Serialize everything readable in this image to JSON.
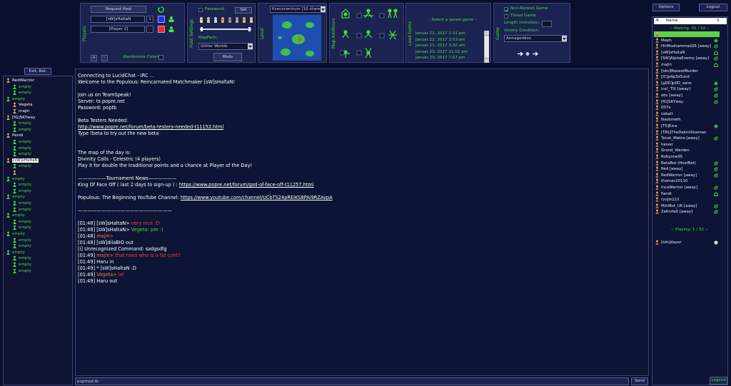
{
  "header": {
    "players_label": "Players",
    "request_host": "Request Host",
    "player1": "[sW]sHaltaN",
    "player1_num": "1",
    "player2": "[Player 2]",
    "player2_num": "-",
    "randomize_colors": "Randomize Colors",
    "host_settings_label": "Host Settings",
    "password_label": "Password:",
    "set_button": "Set",
    "mappack_label": "MapPack:",
    "mappack_value": "Glitter Worlds",
    "mods_button": "Mods",
    "level_label": "Level",
    "level_value": "Kvecocentrum [10 share",
    "map_additions_label": "Map Additions",
    "load_game_label": "Load Game",
    "saved_game_header": "- Select a saved game -",
    "saved_games": [
      "Januar 22, 2017  2:31 pm",
      "Januar 22, 2017  2:53 am",
      "Januar 21, 2017  3:32 am",
      "Januar 20, 2017  11:02 pm",
      "Januar 20, 2017  7:57 pm"
    ],
    "game_label": "Game",
    "non_ranked": "Non-Ranked Game",
    "timed_game": "Timed Game",
    "length_label": "Length (minutes):",
    "length_value": "",
    "victory_label": "Victory Condition:",
    "victory_value": "Armageddon"
  },
  "top_right": {
    "options_button": "Options",
    "logout_button": "Logout"
  },
  "left_panel": {
    "exit_button": "Exit, Bat.",
    "rows": [
      {
        "text": "RedWarrior",
        "indent": 1,
        "kind": "leader"
      },
      {
        "text": "empty",
        "indent": 2,
        "kind": "empty"
      },
      {
        "text": "empty",
        "indent": 2,
        "kind": "empty"
      },
      {
        "text": "empty",
        "indent": 1,
        "kind": "empty"
      },
      {
        "text": "Vegeta",
        "indent": 2,
        "kind": "leader"
      },
      {
        "text": "majin",
        "indent": 2,
        "kind": "leader"
      },
      {
        "text": "[fG]SKYway",
        "indent": 1,
        "kind": "leader"
      },
      {
        "text": "empty",
        "indent": 2,
        "kind": "empty"
      },
      {
        "text": "empty",
        "indent": 2,
        "kind": "empty"
      },
      {
        "text": "Pandi",
        "indent": 1,
        "kind": "leader"
      },
      {
        "text": "empty",
        "indent": 2,
        "kind": "empty"
      },
      {
        "text": "empty",
        "indent": 2,
        "kind": "empty"
      },
      {
        "text": "empty",
        "indent": 2,
        "kind": "empty"
      },
      {
        "text": "[sW]sHaltaN",
        "indent": 1,
        "kind": "self"
      },
      {
        "text": "empty",
        "indent": 2,
        "kind": "empty"
      },
      {
        "text": "",
        "indent": 2,
        "kind": "leader"
      },
      {
        "text": "empty",
        "indent": 1,
        "kind": "empty"
      },
      {
        "text": "empty",
        "indent": 2,
        "kind": "empty"
      },
      {
        "text": "empty",
        "indent": 2,
        "kind": "empty"
      },
      {
        "text": "empty",
        "indent": 1,
        "kind": "empty"
      },
      {
        "text": "empty",
        "indent": 2,
        "kind": "empty"
      },
      {
        "text": "empty",
        "indent": 2,
        "kind": "empty"
      },
      {
        "text": "empty",
        "indent": 1,
        "kind": "empty"
      },
      {
        "text": "empty",
        "indent": 2,
        "kind": "empty"
      },
      {
        "text": "empty",
        "indent": 2,
        "kind": "empty"
      },
      {
        "text": "empty",
        "indent": 1,
        "kind": "empty"
      },
      {
        "text": "empty",
        "indent": 2,
        "kind": "empty"
      },
      {
        "text": "empty",
        "indent": 2,
        "kind": "empty"
      },
      {
        "text": "empty",
        "indent": 1,
        "kind": "empty"
      },
      {
        "text": "empty",
        "indent": 2,
        "kind": "empty"
      },
      {
        "text": "empty",
        "indent": 2,
        "kind": "empty"
      },
      {
        "text": "empty",
        "indent": 2,
        "kind": "empty"
      }
    ]
  },
  "chat": {
    "lines": [
      {
        "text": "Connecting to LucidChat - IRC ...",
        "color": "#ffffff"
      },
      {
        "text": "Welcome to the Populous: Reincarnated Matchmaker [sW]sHaltaN!",
        "color": "#ffffff"
      },
      {
        "text": "",
        "color": "#ffffff"
      },
      {
        "text": "Join us on TeamSpeak!",
        "color": "#ffffff"
      },
      {
        "text": "Server: ts.popre.net",
        "color": "#ffffff"
      },
      {
        "text": "Password: poptb",
        "color": "#ffffff"
      },
      {
        "text": "",
        "color": "#ffffff"
      },
      {
        "text": "Beta Testers Needed:",
        "color": "#ffffff"
      },
      {
        "text": "http://www.popre.net/forum/beta-testers-needed-t11152.html",
        "color": "#ffffff",
        "link": true
      },
      {
        "text": "Type !beta to try out the new beta",
        "color": "#ffffff"
      },
      {
        "text": "",
        "color": "#ffffff"
      },
      {
        "text": "",
        "color": "#ffffff"
      },
      {
        "text": "The map of the day is:",
        "color": "#ffffff"
      },
      {
        "text": "Divinity Calls - Celestric (4 players)",
        "color": "#ffffff"
      },
      {
        "text": "Play it for double the traditional points and a chance at Player of the Day!",
        "color": "#ffffff"
      },
      {
        "text": "",
        "color": "#ffffff"
      },
      {
        "text": "——————Tournament News——————",
        "color": "#ffffff"
      },
      {
        "text": "King Of Face Off ( last 2 days to sign-up ) : https://www.popre.net/forum/god-of-face-off-t11257.html",
        "color": "#ffffff",
        "linkpart": true
      },
      {
        "text": "",
        "color": "#ffffff"
      },
      {
        "text": "Populous: The Beginning YouTube Channel: https://www.youtube.com/channel/UCbTS24pREiKS8PAi9RZAvpA",
        "color": "#ffffff",
        "linkpart": true
      },
      {
        "text": "",
        "color": "#ffffff"
      },
      {
        "text": "————————————————————",
        "color": "#ffffff"
      },
      {
        "text": "",
        "color": "#ffffff"
      }
    ],
    "messages": [
      {
        "time": "[01:48]",
        "nick": "[sW]sHaltaN>",
        "nick_color": "#ffffff",
        "msg": " very nice :D",
        "msg_color": "#ff3b3b"
      },
      {
        "time": "[01:48]",
        "nick": "[sW]sHaltaN>",
        "nick_color": "#ffffff",
        "msg": " Vegeta: pm :)",
        "msg_color": "#4ade3a"
      },
      {
        "time": "[01:48]",
        "nick": "majin>",
        "nick_color": "#ff7a3a",
        "msg": "",
        "msg_color": "#ffffff"
      },
      {
        "time": "[01:48]",
        "nick": "[sW]dilaBIO out",
        "nick_color": "#ffffff",
        "msg": "",
        "msg_color": "#ffffff"
      },
      {
        "time": "[i]",
        "nick": "Unrecognized Command: sadgsdfg",
        "nick_color": "#ffffff",
        "msg": "",
        "msg_color": "#ffffff"
      },
      {
        "time": "[01:49]",
        "nick": "majin>",
        "nick_color": "#ff7a3a",
        "msg": " that noez who is a fat cunt?",
        "msg_color": "#ff3b3b"
      },
      {
        "time": "[01:49]",
        "nick": "Haru in",
        "nick_color": "#ffffff",
        "msg": "",
        "msg_color": "#ffffff"
      },
      {
        "time": "[01:49]",
        "nick": "* [sW]sHaltaN :D",
        "nick_color": "#ffffff",
        "msg": "",
        "msg_color": "#ffffff"
      },
      {
        "time": "[01:49]",
        "nick": "Vegeta>",
        "nick_color": "#ff7a3a",
        "msg": " lol",
        "msg_color": "#ff3b3b"
      },
      {
        "time": "[01:49]",
        "nick": "Haru out",
        "nick_color": "#ffffff",
        "msg": "",
        "msg_color": "#ffffff"
      }
    ],
    "input_value": "popmod.tk",
    "send_button": "Send"
  },
  "userlist": {
    "col_r": "R",
    "col_name": "Name",
    "col_s": "S",
    "waiting_header": "-- Waiting: 31 / 32 --",
    "playing_header": "-- Playing: 1 / 32 --",
    "waiting_users": [
      {
        "name": "",
        "selected": true,
        "status": "home"
      },
      {
        "name": "Meph",
        "status": "star"
      },
      {
        "name": "HirMoohammad26 [away]",
        "status": "run"
      },
      {
        "name": "[sW]sHaltaN",
        "status": "home"
      },
      {
        "name": "[SW]AlphaEnemy [away]",
        "status": "run"
      },
      {
        "name": "majin",
        "status": "home"
      },
      {
        "name": "[tdn]MooestMurder",
        "status": ""
      },
      {
        "name": "[IC]p4p3s0und",
        "status": ""
      },
      {
        "name": "[gDD]p0D_xene",
        "status": "star"
      },
      {
        "name": "ice!_TSI [away]",
        "status": "run"
      },
      {
        "name": "abc [away]",
        "status": "run"
      },
      {
        "name": "[fG]SKYway",
        "status": "run"
      },
      {
        "name": "007x",
        "status": ""
      },
      {
        "name": "cobalt",
        "status": ""
      },
      {
        "name": "Nadsmeth",
        "status": ""
      },
      {
        "name": "[TS]Ezra",
        "status": "star"
      },
      {
        "name": "[TAS]TheDakiniShaman",
        "status": ""
      },
      {
        "name": "Toruk_Makto [away]",
        "status": "run"
      },
      {
        "name": "haiver",
        "status": ""
      },
      {
        "name": "Grand_Warden",
        "status": ""
      },
      {
        "name": "Robyone95",
        "status": ""
      },
      {
        "name": "BetaBot (HostBot)",
        "status": "run"
      },
      {
        "name": "Red [away]",
        "status": "run"
      },
      {
        "name": "RedWarrior [away]",
        "status": "run"
      },
      {
        "name": "thomas10110",
        "status": ""
      },
      {
        "name": "IncaWarrior [away]",
        "status": "run"
      },
      {
        "name": "Pandi",
        "status": "home"
      },
      {
        "name": "ryujin122",
        "status": ""
      },
      {
        "name": "MiniBot_UK [away]",
        "status": "run"
      },
      {
        "name": "ZeKnife0 [away]",
        "status": "run"
      }
    ],
    "playing_users": [
      {
        "name": "[tdn]dayer",
        "status": "dot"
      }
    ],
    "legend_button": "Legend"
  },
  "colors": {
    "background": "#0a0f2e",
    "panel": "#1b2350",
    "accent_green": "#4ade3a",
    "player_blue": "#2030ff",
    "player_red": "#ff2020"
  }
}
